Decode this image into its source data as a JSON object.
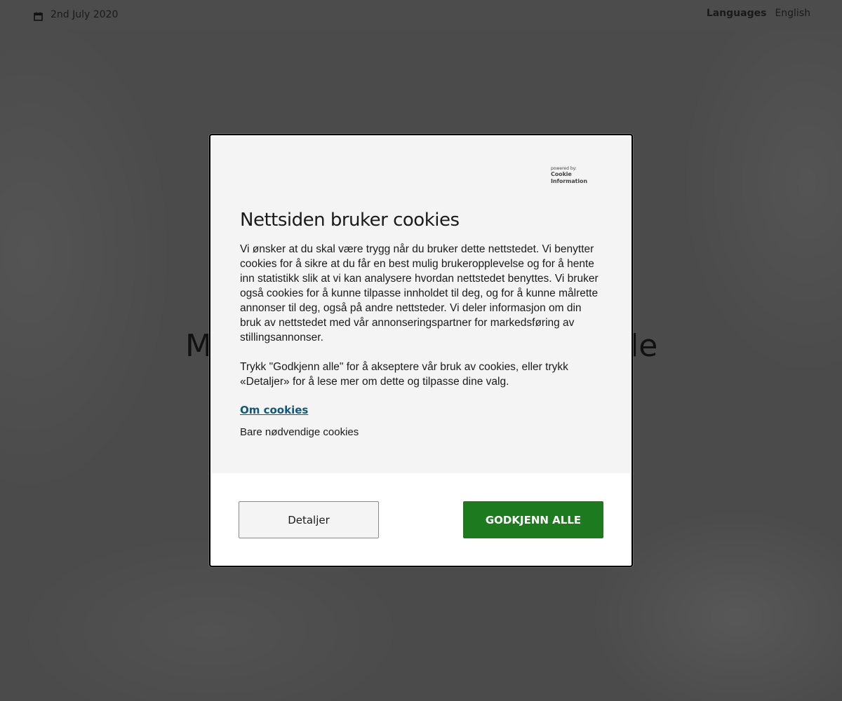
{
  "header": {
    "date": "2nd July 2020",
    "date_icon": "calendar-icon",
    "languages_label": "Languages",
    "language_value": "English"
  },
  "hero": {
    "left_fragment": "M",
    "right_fragment": "le"
  },
  "cookie_dialog": {
    "powered_by_label": "powered by:",
    "powered_by_brand": "Cookie Information",
    "title": "Nettsiden bruker cookies",
    "body": "Vi ønsker at du skal være trygg når du bruker dette nettstedet. Vi benytter cookies for å sikre at du får en best mulig brukeropplevelse og for å hente inn statistikk slik at vi kan analysere hvordan nettstedet benyttes. Vi bruker også cookies for å kunne tilpasse innholdet til deg, og for å kunne målrette annonser til deg, også på andre nettsteder. Vi deler informasjon om din bruk av nettstedet med vår annonseringspartner for markedsføring av stillingsannonser.",
    "body_instructions": "Trykk \"Godkjenn alle\" for å akseptere vår bruk av cookies, eller trykk «Detaljer» for å lese mer om dette og tilpasse dine valg.",
    "about_link": "Om cookies",
    "necessary_only": "Bare nødvendige cookies",
    "details_button": "Detaljer",
    "accept_button": "GODKJENN ALLE",
    "accept_color": "#1e7a1e",
    "link_color": "#0e5a78"
  }
}
